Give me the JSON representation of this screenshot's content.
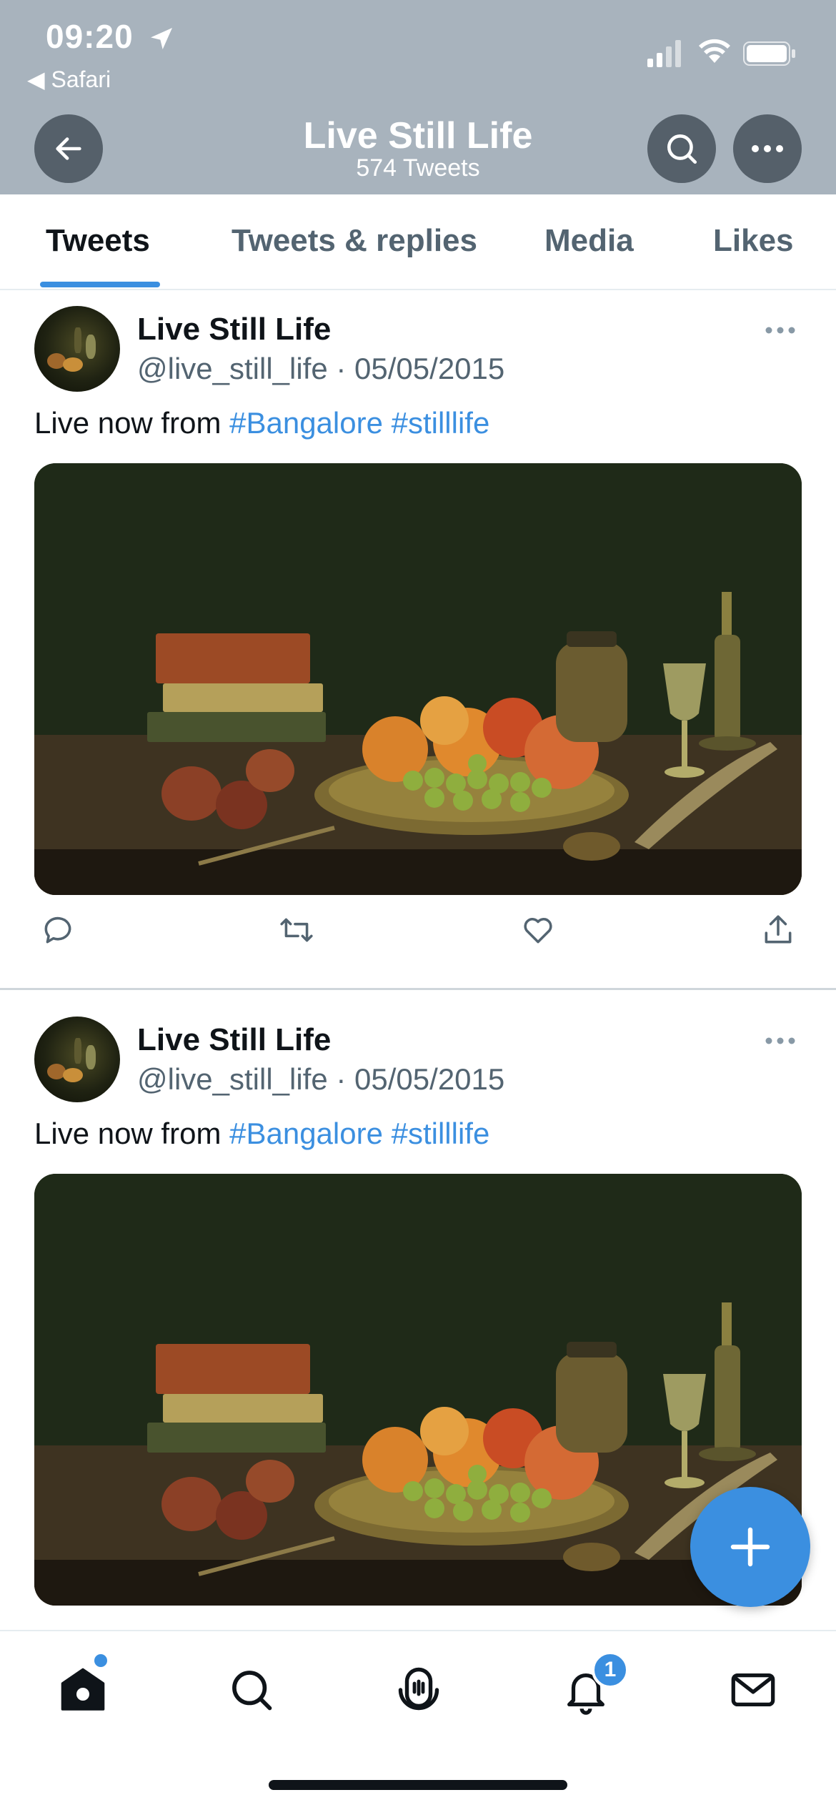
{
  "status_bar": {
    "time": "09:20",
    "back_app": "◀ Safari"
  },
  "header": {
    "title": "Live Still Life",
    "subtitle": "574 Tweets"
  },
  "tabs": [
    {
      "label": "Tweets",
      "active": true
    },
    {
      "label": "Tweets & replies",
      "active": false
    },
    {
      "label": "Media",
      "active": false
    },
    {
      "label": "Likes",
      "active": false
    }
  ],
  "tweets": [
    {
      "author": "Live Still Life",
      "handle_date": "@live_still_life · 05/05/2015",
      "text_plain": "Live now from ",
      "hashtags": "#Bangalore #stilllife",
      "media": "still-life-photo"
    },
    {
      "author": "Live Still Life",
      "handle_date": "@live_still_life · 05/05/2015",
      "text_plain": "Live now from ",
      "hashtags": "#Bangalore #stilllife",
      "media": "still-life-photo"
    }
  ],
  "bottom_nav": {
    "items": [
      "home-icon",
      "search-icon",
      "spaces-icon",
      "notifications-icon",
      "messages-icon"
    ],
    "notification_count": "1"
  },
  "colors": {
    "accent": "#3b8fe0",
    "header_bg": "#a8b3bd",
    "header_button": "#55606a",
    "secondary_text": "#536471"
  }
}
